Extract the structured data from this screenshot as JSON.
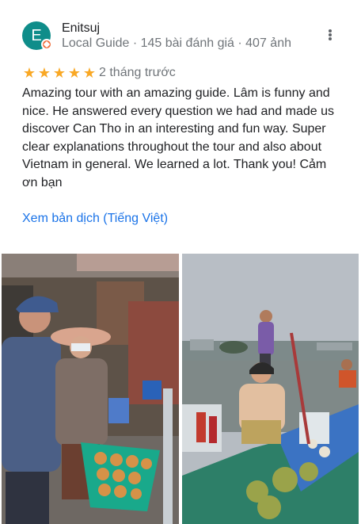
{
  "review": {
    "author": {
      "avatar_letter": "E",
      "name": "Enitsuj",
      "meta": "Local Guide · 145 bài đánh giá · 407 ảnh",
      "badge_icon": "local-guide-badge-icon"
    },
    "rating": 5,
    "stars": [
      "★",
      "★",
      "★",
      "★",
      "★"
    ],
    "time": "2 tháng trước",
    "text": "Amazing tour with an amazing guide. Lâm is funny and nice. He answered every question we had and made us discover Can Tho in an interesting and fun way. Super clear explanations throughout the tour and also about Vietnam in general. We learned a lot. Thank you! Cảm ơn bạn",
    "translate_link": "Xem bản dịch (Tiếng Việt)",
    "menu_icon": "more-vert-icon"
  },
  "colors": {
    "avatar": "#0f8d8a",
    "badge": "#ef6c3a",
    "star": "#f9a825",
    "link": "#1a73e8",
    "secondary_text": "#70757a"
  },
  "photos": [
    {
      "name": "market-photo",
      "description_icon": "photo-market"
    },
    {
      "name": "floating-market-photo",
      "description_icon": "photo-boats"
    }
  ]
}
